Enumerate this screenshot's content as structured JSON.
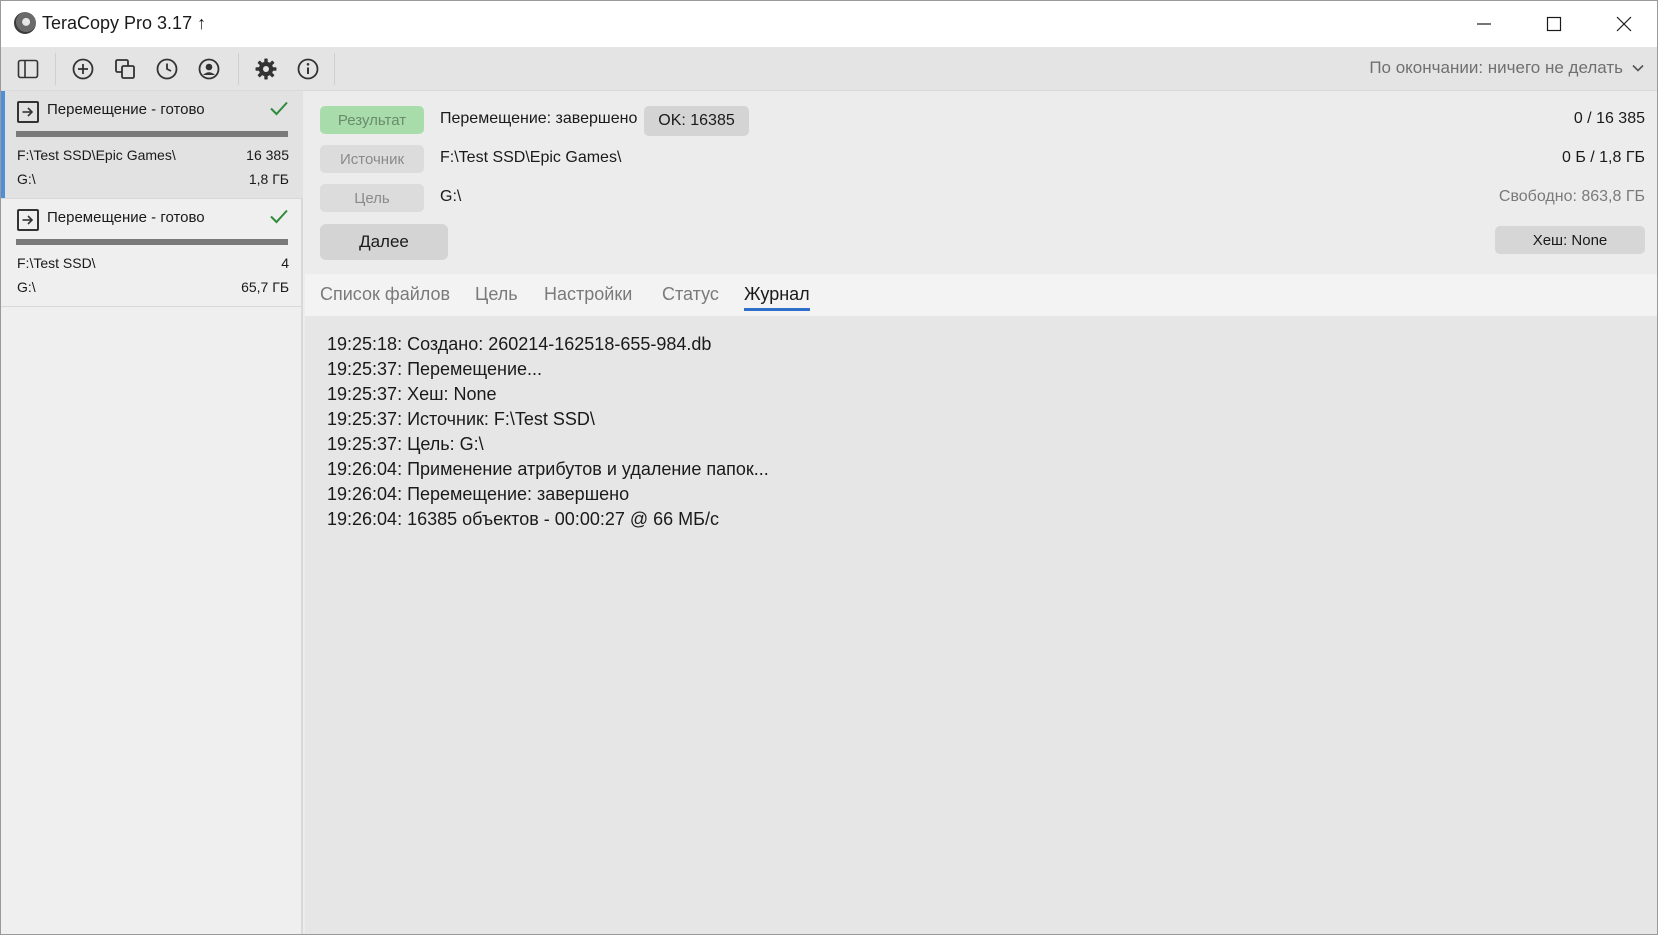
{
  "window": {
    "title": "TeraCopy Pro 3.17 ↑"
  },
  "toolbar": {
    "icons": [
      "sidebar-toggle-icon",
      "add-icon",
      "copy-icon",
      "history-icon",
      "profile-icon",
      "settings-icon",
      "info-icon"
    ],
    "on_finish": "По окончании: ничего не делать"
  },
  "jobs": [
    {
      "title": "Перемещение - готово",
      "status": "done",
      "progress": 1.0,
      "source": "F:\\Test SSD\\Epic Games\\",
      "count": "16 385",
      "target": "G:\\",
      "size": "1,8 ГБ"
    },
    {
      "title": "Перемещение - готово",
      "status": "done",
      "progress": 1.0,
      "source": "F:\\Test SSD\\",
      "count": "4",
      "target": "G:\\",
      "size": "65,7 ГБ"
    }
  ],
  "summary": {
    "result_label": "Результат",
    "result_text": "Перемещение: завершено",
    "ok_badge": "OK: 16385",
    "files_progress": "0 / 16 385",
    "source_label": "Источник",
    "source_path": "F:\\Test SSD\\Epic Games\\",
    "size_progress": "0 Б / 1,8 ГБ",
    "target_label": "Цель",
    "target_path": "G:\\",
    "free_space": "Свободно: 863,8 ГБ",
    "next_button": "Далее",
    "hash_button": "Хеш: None"
  },
  "tabs": [
    {
      "label": "Список файлов",
      "active": false
    },
    {
      "label": "Цель",
      "active": false
    },
    {
      "label": "Настройки",
      "active": false
    },
    {
      "label": "Статус",
      "active": false
    },
    {
      "label": "Журнал",
      "active": true
    }
  ],
  "log": [
    "19:25:18: Создано: 260214-162518-655-984.db",
    "19:25:37: Перемещение...",
    "19:25:37: Хеш: None",
    "19:25:37: Источник: F:\\Test SSD\\",
    "19:25:37: Цель: G:\\",
    "19:26:04: Применение атрибутов и удаление папок...",
    "19:26:04: Перемещение: завершено",
    "19:26:04: 16385 объектов - 00:00:27 @ 66 МБ/с"
  ],
  "colors": {
    "accent": "#2f6fc9",
    "result_green": "#a8dcab",
    "check_green": "#2e8b3a",
    "selection_bar": "#4f8fd8"
  }
}
